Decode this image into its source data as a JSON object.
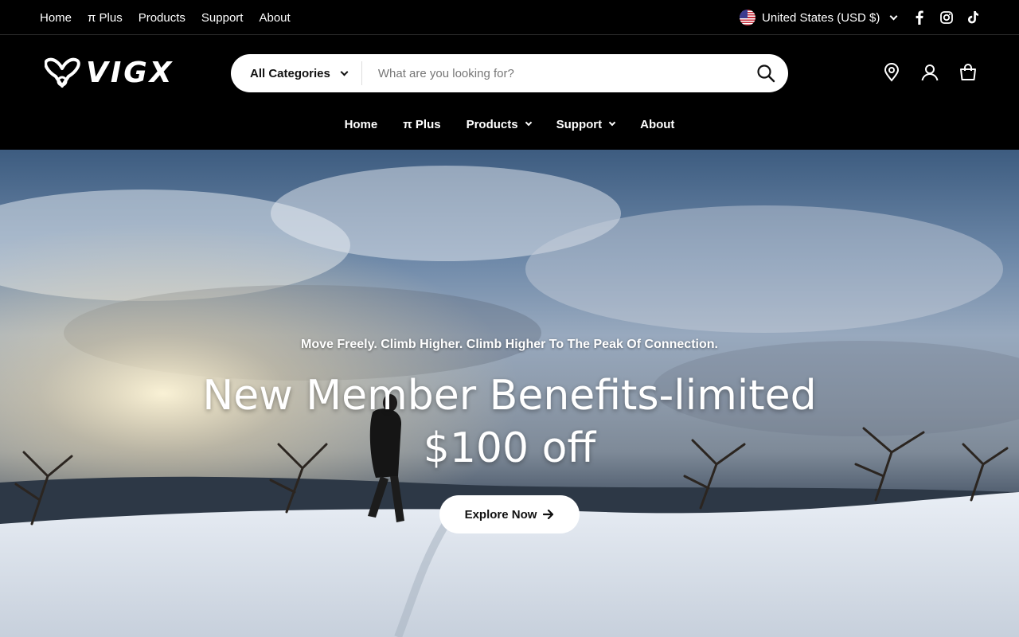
{
  "topbar": {
    "links": [
      "Home",
      "π Plus",
      "Products",
      "Support",
      "About"
    ],
    "locale": "United States (USD $)",
    "locale_flag": "us-flag-icon",
    "socials": [
      "facebook-icon",
      "instagram-icon",
      "tiktok-icon"
    ]
  },
  "header": {
    "logo_text": "VIGX",
    "search": {
      "category": "All Categories",
      "placeholder": "What are you looking for?"
    },
    "icons": [
      "store-locator-icon",
      "account-icon",
      "cart-icon"
    ],
    "nav": [
      {
        "label": "Home",
        "dropdown": false
      },
      {
        "label": "π Plus",
        "dropdown": false
      },
      {
        "label": "Products",
        "dropdown": true
      },
      {
        "label": "Support",
        "dropdown": true
      },
      {
        "label": "About",
        "dropdown": false
      }
    ]
  },
  "hero": {
    "tagline": "Move Freely. Climb Higher. Climb Higher To The Peak Of Connection.",
    "headline_line1": "New Member Benefits-limited",
    "headline_line2": "$100 off",
    "cta": "Explore Now"
  },
  "colors": {
    "background": "#000000",
    "button_bg": "#ffffff",
    "text": "#ffffff"
  }
}
